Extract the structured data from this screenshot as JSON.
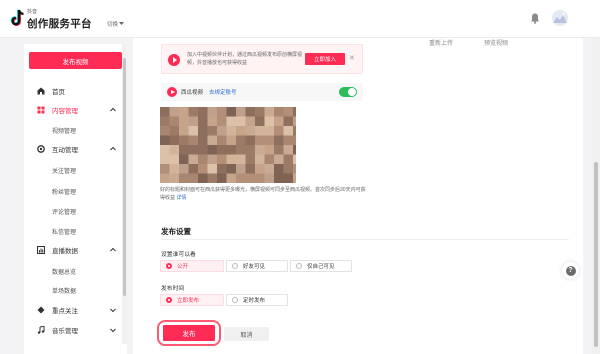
{
  "header": {
    "logo_sub": "抖音",
    "logo_title": "创作服务平台",
    "switch_label": "切换",
    "icons": [
      "douyin-logo-icon",
      "bell-icon",
      "avatar"
    ]
  },
  "sidebar": {
    "publish_button": "发布视频",
    "items": [
      {
        "label": "首页",
        "icon": "home-icon"
      },
      {
        "label": "内容管理",
        "icon": "content-icon",
        "active": true,
        "expanded": true
      },
      {
        "label": "视频管理"
      },
      {
        "label": "互动管理",
        "icon": "interaction-icon",
        "expanded": true
      },
      {
        "label": "关注管理"
      },
      {
        "label": "粉丝管理"
      },
      {
        "label": "评论管理"
      },
      {
        "label": "私信管理"
      },
      {
        "label": "直播数据",
        "icon": "live-data-icon",
        "expanded": true
      },
      {
        "label": "数据总览"
      },
      {
        "label": "单场数据"
      },
      {
        "label": "重点关注",
        "icon": "focus-icon",
        "expanded": false
      },
      {
        "label": "音乐管理",
        "icon": "music-icon",
        "expanded": false
      }
    ]
  },
  "main": {
    "top_tabs": [
      "重新上传",
      "预览视频"
    ],
    "promo": {
      "text": "加入中视频伙伴计划，通过西瓜视频发布原创横屏视频，抖音播放也可获得收益",
      "button": "立即加入",
      "close": "✕"
    },
    "xigua": {
      "name": "西瓜视频",
      "bind_link": "去绑定账号",
      "toggle_on": true
    },
    "note": {
      "text": "好的标题和封面可在西瓜获得更多曝光，横屏视频可同步至西瓜视频。首次同步后30天内可获得收益",
      "link": "详情"
    },
    "publish_settings": {
      "title": "发布设置",
      "visibility_label": "设置谁可以看",
      "visibility_options": [
        "公开",
        "好友可见",
        "仅自己可见"
      ],
      "visibility_selected": "公开",
      "time_label": "发布时间",
      "time_options": [
        "立即发布",
        "定时发布"
      ],
      "time_selected": "立即发布"
    },
    "submit_button": "发布",
    "cancel_button": "取消"
  },
  "help": {
    "icon": "help-icon",
    "glyph": "?"
  },
  "colors": {
    "accent": "#fe2c55",
    "link": "#2f6bd9",
    "toggle": "#2dbb5b"
  }
}
